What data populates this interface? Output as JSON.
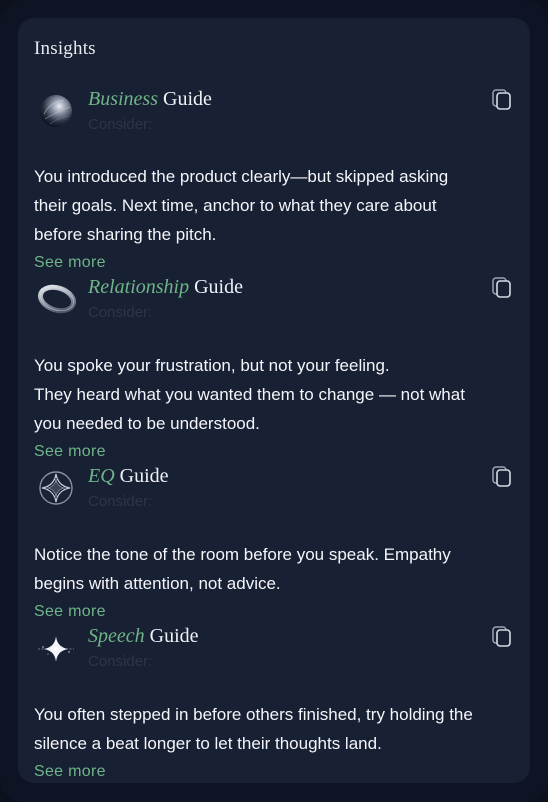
{
  "panel": {
    "title": "Insights"
  },
  "cards": [
    {
      "keyword": "Business",
      "suffix": "Guide",
      "consider": "Consider:",
      "icon": "sphere-icon",
      "lines": [
        "You introduced the product clearly—but skipped asking",
        "their goals. Next time, anchor to what they care about",
        "before sharing the pitch."
      ],
      "see_more": "See more"
    },
    {
      "keyword": "Relationship",
      "suffix": "Guide",
      "consider": "Consider:",
      "icon": "ring-icon",
      "lines": [
        "You spoke your frustration, but not your feeling.",
        "They heard what you wanted them to change — not what",
        "you needed to be understood."
      ],
      "see_more": "See more"
    },
    {
      "keyword": "EQ",
      "suffix": "Guide",
      "consider": "Consider:",
      "icon": "star-orb-icon",
      "lines": [
        "Notice the tone of the room before you speak. Empathy",
        "begins with attention, not advice."
      ],
      "see_more": "See more"
    },
    {
      "keyword": "Speech",
      "suffix": "Guide",
      "consider": "Consider:",
      "icon": "sparkle-icon",
      "lines": [
        "You often stepped in before others finished, try holding the",
        "silence a beat longer to let their thoughts land."
      ],
      "see_more": "See more"
    }
  ],
  "colors": {
    "accent": "#6fb489",
    "panel_bg": "#182033",
    "frame_bg": "#0e1423",
    "text": "#f3f5f9",
    "muted": "#2c3549"
  }
}
